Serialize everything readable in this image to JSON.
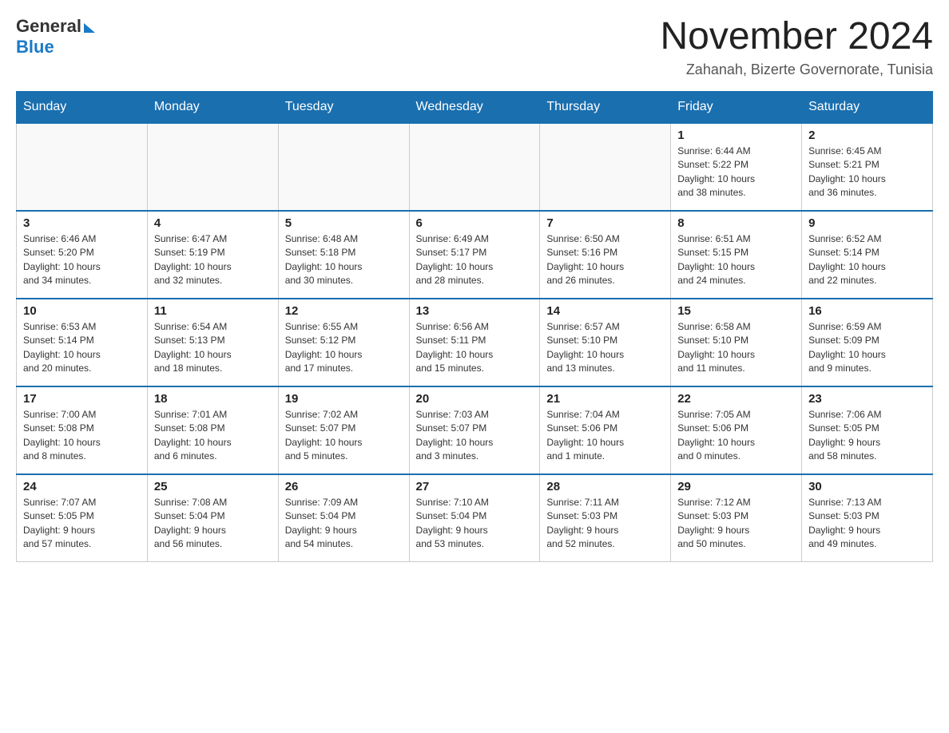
{
  "logo": {
    "general_text": "General",
    "blue_text": "Blue"
  },
  "header": {
    "month_title": "November 2024",
    "location": "Zahanah, Bizerte Governorate, Tunisia"
  },
  "weekdays": [
    "Sunday",
    "Monday",
    "Tuesday",
    "Wednesday",
    "Thursday",
    "Friday",
    "Saturday"
  ],
  "weeks": [
    {
      "days": [
        {
          "num": "",
          "info": ""
        },
        {
          "num": "",
          "info": ""
        },
        {
          "num": "",
          "info": ""
        },
        {
          "num": "",
          "info": ""
        },
        {
          "num": "",
          "info": ""
        },
        {
          "num": "1",
          "info": "Sunrise: 6:44 AM\nSunset: 5:22 PM\nDaylight: 10 hours\nand 38 minutes."
        },
        {
          "num": "2",
          "info": "Sunrise: 6:45 AM\nSunset: 5:21 PM\nDaylight: 10 hours\nand 36 minutes."
        }
      ]
    },
    {
      "days": [
        {
          "num": "3",
          "info": "Sunrise: 6:46 AM\nSunset: 5:20 PM\nDaylight: 10 hours\nand 34 minutes."
        },
        {
          "num": "4",
          "info": "Sunrise: 6:47 AM\nSunset: 5:19 PM\nDaylight: 10 hours\nand 32 minutes."
        },
        {
          "num": "5",
          "info": "Sunrise: 6:48 AM\nSunset: 5:18 PM\nDaylight: 10 hours\nand 30 minutes."
        },
        {
          "num": "6",
          "info": "Sunrise: 6:49 AM\nSunset: 5:17 PM\nDaylight: 10 hours\nand 28 minutes."
        },
        {
          "num": "7",
          "info": "Sunrise: 6:50 AM\nSunset: 5:16 PM\nDaylight: 10 hours\nand 26 minutes."
        },
        {
          "num": "8",
          "info": "Sunrise: 6:51 AM\nSunset: 5:15 PM\nDaylight: 10 hours\nand 24 minutes."
        },
        {
          "num": "9",
          "info": "Sunrise: 6:52 AM\nSunset: 5:14 PM\nDaylight: 10 hours\nand 22 minutes."
        }
      ]
    },
    {
      "days": [
        {
          "num": "10",
          "info": "Sunrise: 6:53 AM\nSunset: 5:14 PM\nDaylight: 10 hours\nand 20 minutes."
        },
        {
          "num": "11",
          "info": "Sunrise: 6:54 AM\nSunset: 5:13 PM\nDaylight: 10 hours\nand 18 minutes."
        },
        {
          "num": "12",
          "info": "Sunrise: 6:55 AM\nSunset: 5:12 PM\nDaylight: 10 hours\nand 17 minutes."
        },
        {
          "num": "13",
          "info": "Sunrise: 6:56 AM\nSunset: 5:11 PM\nDaylight: 10 hours\nand 15 minutes."
        },
        {
          "num": "14",
          "info": "Sunrise: 6:57 AM\nSunset: 5:10 PM\nDaylight: 10 hours\nand 13 minutes."
        },
        {
          "num": "15",
          "info": "Sunrise: 6:58 AM\nSunset: 5:10 PM\nDaylight: 10 hours\nand 11 minutes."
        },
        {
          "num": "16",
          "info": "Sunrise: 6:59 AM\nSunset: 5:09 PM\nDaylight: 10 hours\nand 9 minutes."
        }
      ]
    },
    {
      "days": [
        {
          "num": "17",
          "info": "Sunrise: 7:00 AM\nSunset: 5:08 PM\nDaylight: 10 hours\nand 8 minutes."
        },
        {
          "num": "18",
          "info": "Sunrise: 7:01 AM\nSunset: 5:08 PM\nDaylight: 10 hours\nand 6 minutes."
        },
        {
          "num": "19",
          "info": "Sunrise: 7:02 AM\nSunset: 5:07 PM\nDaylight: 10 hours\nand 5 minutes."
        },
        {
          "num": "20",
          "info": "Sunrise: 7:03 AM\nSunset: 5:07 PM\nDaylight: 10 hours\nand 3 minutes."
        },
        {
          "num": "21",
          "info": "Sunrise: 7:04 AM\nSunset: 5:06 PM\nDaylight: 10 hours\nand 1 minute."
        },
        {
          "num": "22",
          "info": "Sunrise: 7:05 AM\nSunset: 5:06 PM\nDaylight: 10 hours\nand 0 minutes."
        },
        {
          "num": "23",
          "info": "Sunrise: 7:06 AM\nSunset: 5:05 PM\nDaylight: 9 hours\nand 58 minutes."
        }
      ]
    },
    {
      "days": [
        {
          "num": "24",
          "info": "Sunrise: 7:07 AM\nSunset: 5:05 PM\nDaylight: 9 hours\nand 57 minutes."
        },
        {
          "num": "25",
          "info": "Sunrise: 7:08 AM\nSunset: 5:04 PM\nDaylight: 9 hours\nand 56 minutes."
        },
        {
          "num": "26",
          "info": "Sunrise: 7:09 AM\nSunset: 5:04 PM\nDaylight: 9 hours\nand 54 minutes."
        },
        {
          "num": "27",
          "info": "Sunrise: 7:10 AM\nSunset: 5:04 PM\nDaylight: 9 hours\nand 53 minutes."
        },
        {
          "num": "28",
          "info": "Sunrise: 7:11 AM\nSunset: 5:03 PM\nDaylight: 9 hours\nand 52 minutes."
        },
        {
          "num": "29",
          "info": "Sunrise: 7:12 AM\nSunset: 5:03 PM\nDaylight: 9 hours\nand 50 minutes."
        },
        {
          "num": "30",
          "info": "Sunrise: 7:13 AM\nSunset: 5:03 PM\nDaylight: 9 hours\nand 49 minutes."
        }
      ]
    }
  ]
}
